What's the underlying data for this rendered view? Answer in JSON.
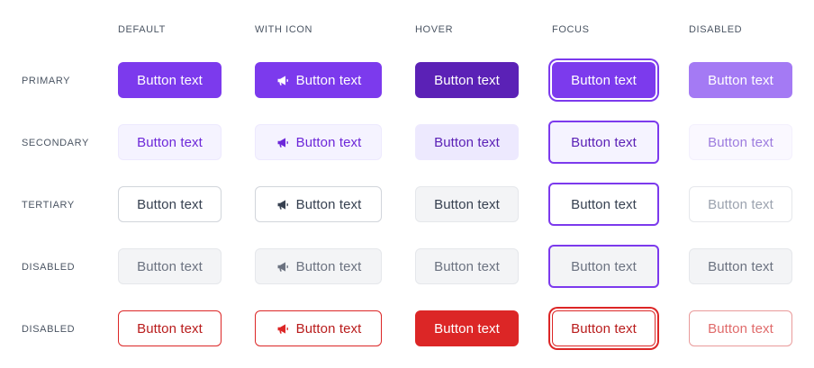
{
  "columns": [
    "DEFAULT",
    "WITH ICON",
    "HOVER",
    "FOCUS",
    "DISABLED"
  ],
  "rows": [
    "PRIMARY",
    "SECONDARY",
    "TERTIARY",
    "DISABLED",
    "DISABLED"
  ],
  "button_label": "Button text",
  "icon": "megaphone-icon",
  "colors": {
    "primary": "#7c3aed",
    "primary_hover": "#5b21b6",
    "secondary_bg": "#f5f3ff",
    "tertiary_text": "#374151",
    "disabled_bg": "#f3f4f6",
    "danger": "#dc2626"
  }
}
